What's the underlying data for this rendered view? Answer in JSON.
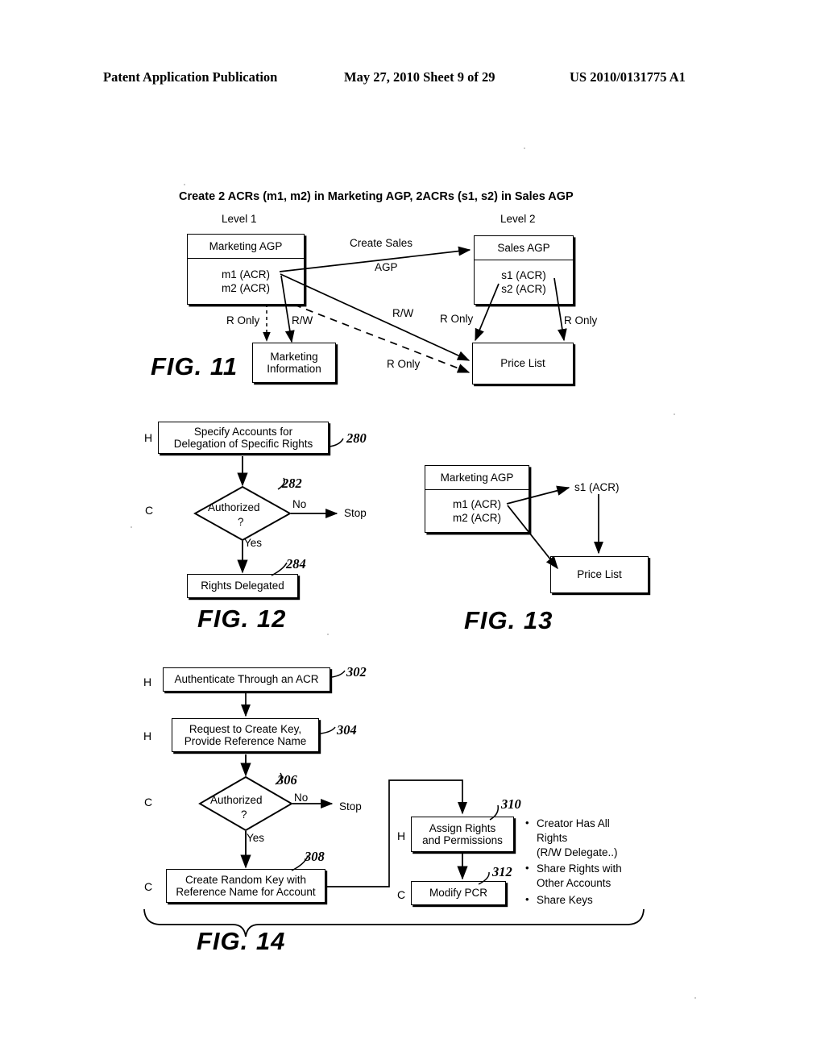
{
  "header": {
    "left": "Patent Application Publication",
    "middle": "May 27, 2010  Sheet 9 of 29",
    "right": "US 2010/0131775 A1"
  },
  "fig11": {
    "caption": "FIG. 11",
    "title": "Create 2 ACRs (m1, m2) in Marketing AGP, 2ACRs (s1, s2) in Sales AGP",
    "level1": "Level 1",
    "level2": "Level 2",
    "marketing_agp": {
      "header": "Marketing AGP",
      "acr1": "m1 (ACR)",
      "acr2": "m2 (ACR)"
    },
    "sales_agp": {
      "header": "Sales AGP",
      "acr1": "s1 (ACR)",
      "acr2": "s2 (ACR)"
    },
    "marketing_information": "Marketing\nInformation",
    "marketing_information_l1": "Marketing",
    "marketing_information_l2": "Information",
    "price_list": "Price List",
    "edge_create_sales_l1": "Create Sales",
    "edge_create_sales_l2": "AGP",
    "edge_r_only_mi": "R Only",
    "edge_rw_mi": "R/W",
    "edge_rw_pl": "R/W",
    "edge_r_only_dashed": "R Only",
    "edge_r_only_s1": "R Only",
    "edge_r_only_s2": "R Only"
  },
  "fig12": {
    "caption": "FIG. 12",
    "step280": {
      "line1": "Specify Accounts for",
      "line2": "Delegation of Specific Rights",
      "ref": "280",
      "actor": "H"
    },
    "step282": {
      "line1": "Authorized",
      "line2": "?",
      "ref": "282",
      "actor": "C",
      "no_label": "No",
      "yes_label": "Yes",
      "stop_label": "Stop"
    },
    "step284": {
      "label": "Rights Delegated",
      "ref": "284"
    }
  },
  "fig13": {
    "caption": "FIG. 13",
    "marketing_agp": {
      "header": "Marketing AGP",
      "acr1": "m1 (ACR)",
      "acr2": "m2 (ACR)"
    },
    "s1_label": "s1 (ACR)",
    "price_list": "Price List"
  },
  "fig14": {
    "caption": "FIG. 14",
    "step302": {
      "label": "Authenticate Through an ACR",
      "ref": "302",
      "actor": "H"
    },
    "step304": {
      "line1": "Request to Create Key,",
      "line2": "Provide Reference Name",
      "ref": "304",
      "actor": "H"
    },
    "step306": {
      "line1": "Authorized",
      "line2": "?",
      "ref": "306",
      "actor": "C",
      "no_label": "No",
      "yes_label": "Yes",
      "stop_label": "Stop"
    },
    "step308": {
      "line1": "Create Random Key with",
      "line2": "Reference Name for Account",
      "ref": "308",
      "actor": "C"
    },
    "step310": {
      "line1": "Assign Rights",
      "line2": "and Permissions",
      "ref": "310",
      "actor": "H"
    },
    "step312": {
      "label": "Modify PCR",
      "ref": "312",
      "actor": "C"
    },
    "notes": [
      "Creator Has All Rights (R/W Delegate..)",
      "Share Rights with Other Accounts",
      "Share Keys"
    ],
    "note_lines": {
      "n1l1": "Creator Has All",
      "n1l2": "Rights",
      "n1l3": "(R/W Delegate..)",
      "n2l1": "Share Rights with",
      "n2l2": "Other Accounts",
      "n3l1": "Share Keys"
    }
  }
}
